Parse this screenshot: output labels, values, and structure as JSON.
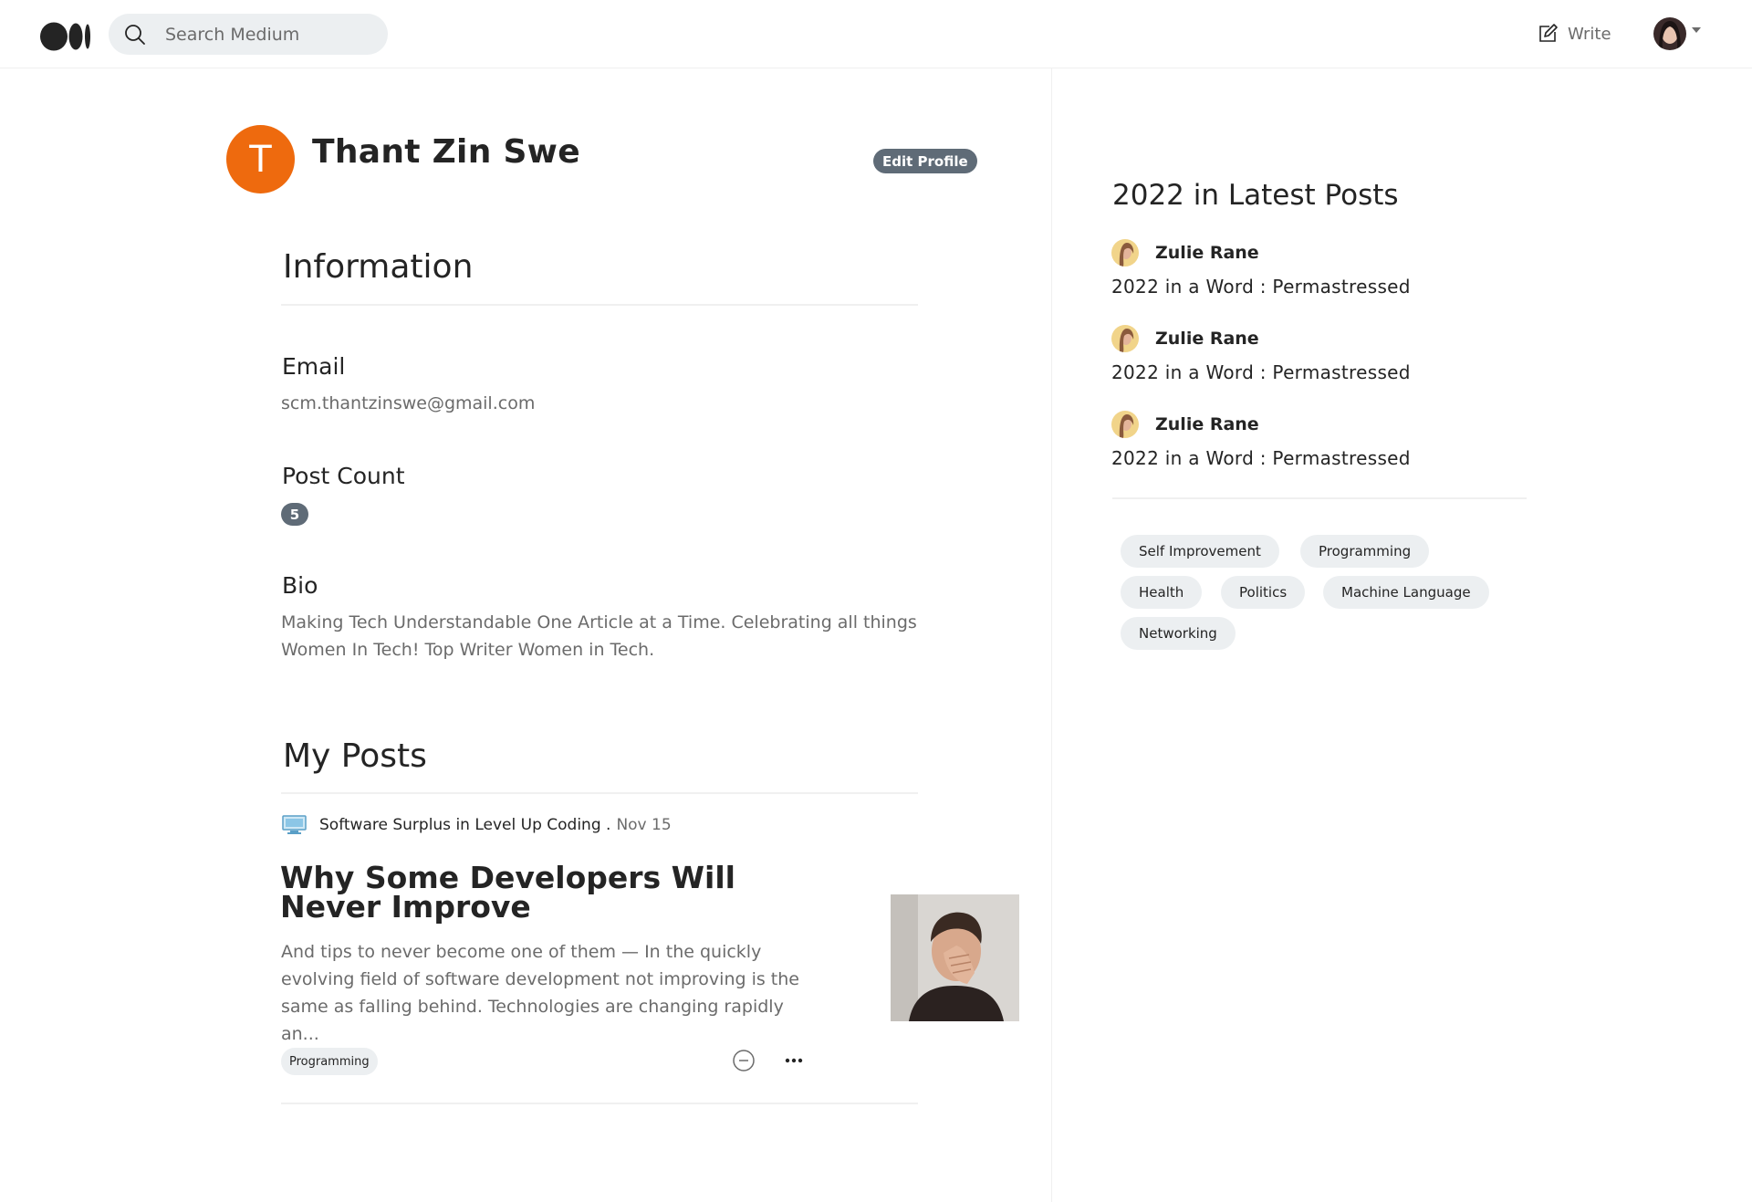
{
  "header": {
    "search_placeholder": "Search Medium",
    "write_label": "Write",
    "icons": [
      "medium-logo-icon",
      "search-icon",
      "write-icon",
      "chevron-down-icon"
    ]
  },
  "profile": {
    "initial": "T",
    "name": "Thant Zin Swe",
    "edit_label": "Edit Profile",
    "avatar_color": "#ee6a0e"
  },
  "information": {
    "title": "Information",
    "email_label": "Email",
    "email_value": "scm.thantzinswe@gmail.com",
    "post_count_label": "Post Count",
    "post_count_value": "5",
    "bio_label": "Bio",
    "bio_value": "Making Tech Understandable One Article at a Time. Celebrating all things Women In Tech! Top Writer Women in Tech."
  },
  "posts": {
    "title": "My Posts",
    "items": [
      {
        "publication": "Software Surplus in Level Up Coding .",
        "date": "Nov 15",
        "title": "Why Some Developers Will Never Improve",
        "excerpt": "And tips to never become one of them — In the quickly evolving field of software development not improving is the same as falling behind. Technologies are changing rapidly an...",
        "tag": "Programming"
      }
    ]
  },
  "sidebar": {
    "title": "2022 in Latest Posts",
    "latest": [
      {
        "author": "Zulie Rane",
        "title": "2022 in a Word : Permastressed"
      },
      {
        "author": "Zulie Rane",
        "title": "2022 in a Word : Permastressed"
      },
      {
        "author": "Zulie Rane",
        "title": "2022 in a Word : Permastressed"
      }
    ],
    "tags": [
      "Self Improvement",
      "Programming",
      "Health",
      "Politics",
      "Machine Language",
      "Networking"
    ]
  }
}
